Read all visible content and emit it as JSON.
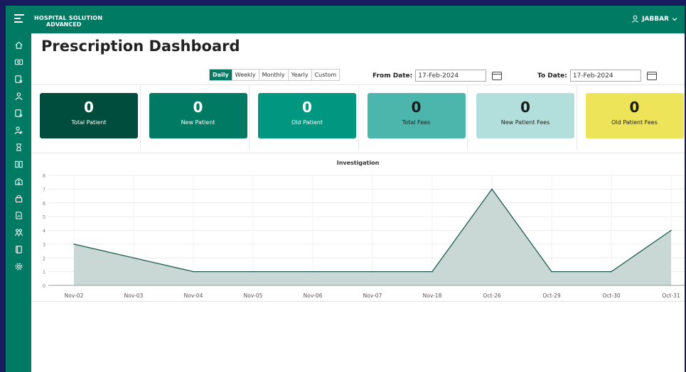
{
  "app": {
    "brand_line1": "HOSPITAL SOLUTION",
    "brand_line2": "ADVANCED",
    "user_name": "JABBAR"
  },
  "sidebar": {
    "items": [
      "home-icon",
      "money-icon",
      "prescription-icon",
      "user-icon",
      "prescription-alt-icon",
      "user-add-icon",
      "hourglass-icon",
      "columns-icon",
      "hospital-icon",
      "lock-icon",
      "refresh-doc-icon",
      "group-icon",
      "book-icon",
      "settings-icon"
    ]
  },
  "page": {
    "title": "Prescription Dashboard"
  },
  "period_tabs": [
    "Daily",
    "Weekly",
    "Monthly",
    "Yearly",
    "Custom"
  ],
  "active_period": "Daily",
  "filters": {
    "from_label": "From Date:",
    "from_value": "17-Feb-2024",
    "to_label": "To Date:",
    "to_value": "17-Feb-2024"
  },
  "cards": [
    {
      "value": "0",
      "label": "Total Patient",
      "bg": "#004d3d",
      "fg": "#ffffff"
    },
    {
      "value": "0",
      "label": "New Patient",
      "bg": "#007a63",
      "fg": "#ffffff"
    },
    {
      "value": "0",
      "label": "Old Patient",
      "bg": "#009680",
      "fg": "#ffffff"
    },
    {
      "value": "0",
      "label": "Total Fees",
      "bg": "#4db6ac",
      "fg": "#1b1b1b"
    },
    {
      "value": "0",
      "label": "New Patient Fees",
      "bg": "#b2dfdb",
      "fg": "#1b1b1b"
    },
    {
      "value": "0",
      "label": "Old Patient Fees",
      "bg": "#ede45a",
      "fg": "#1b1b1b"
    }
  ],
  "chart_data": {
    "type": "area",
    "title": "Investigation",
    "categories": [
      "Nov-02",
      "Nov-03",
      "Nov-04",
      "Nov-05",
      "Nov-06",
      "Nov-07",
      "Nov-18",
      "Oct-26",
      "Oct-29",
      "Oct-30",
      "Oct-31"
    ],
    "values": [
      3,
      2,
      1,
      1,
      1,
      1,
      1,
      7,
      1,
      1,
      4
    ],
    "ylim": [
      0,
      8
    ],
    "yticks": [
      0,
      1,
      2,
      3,
      4,
      5,
      6,
      7,
      8
    ],
    "grid": true,
    "line_color": "#1f5c4f",
    "fill_color": "#c9d8d5"
  }
}
